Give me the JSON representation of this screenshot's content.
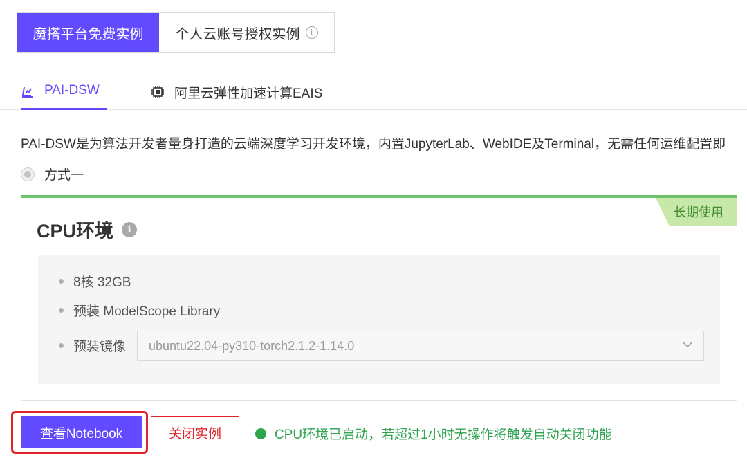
{
  "instance_tabs": {
    "active": "魔搭平台免费实例",
    "inactive": "个人云账号授权实例",
    "info_glyph": "i"
  },
  "product_tabs": [
    {
      "label": "PAI-DSW",
      "icon": "pai-dsw-icon"
    },
    {
      "label": "阿里云弹性加速计算EAIS",
      "icon": "chip-icon"
    }
  ],
  "description": "PAI-DSW是为算法开发者量身打造的云端深度学习开发环境，内置JupyterLab、WebIDE及Terminal，无需任何运维配置即",
  "method": {
    "label": "方式一"
  },
  "card": {
    "ribbon": "长期使用",
    "title": "CPU环境",
    "info_glyph": "i",
    "specs": [
      "8核 32GB",
      "预装 ModelScope Library",
      "预装镜像"
    ],
    "image_select": {
      "value": "ubuntu22.04-py310-torch2.1.2-1.14.0"
    }
  },
  "actions": {
    "view_notebook": "查看Notebook",
    "close_instance": "关闭实例",
    "status": "CPU环境已启动，若超过1小时无操作将触发自动关闭功能"
  },
  "colors": {
    "primary": "#624aff",
    "danger": "#e0242b",
    "success": "#2ea44f",
    "ribbon": "#c7e8a8"
  }
}
